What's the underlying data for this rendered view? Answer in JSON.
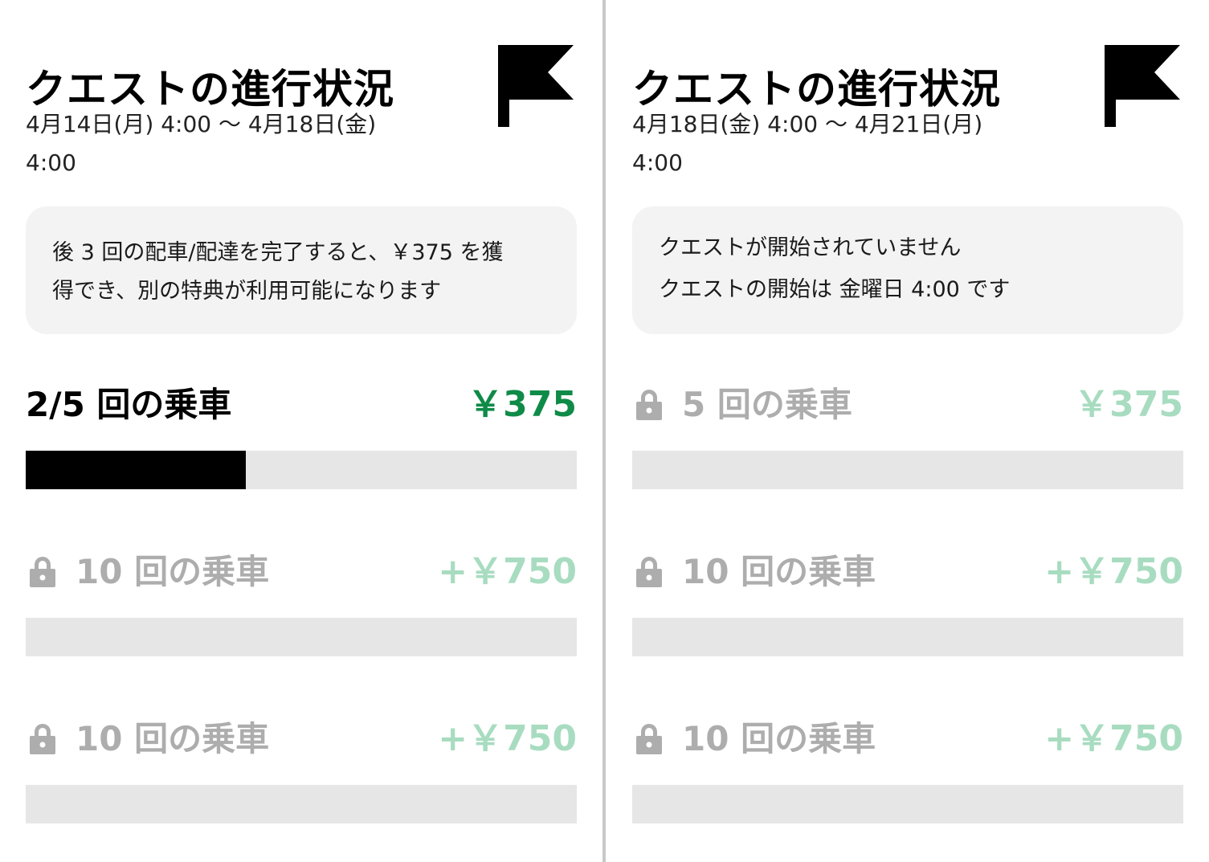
{
  "colors": {
    "reward_active": "#0f8b48",
    "reward_muted": "#a8dcc0",
    "label_muted": "#adadad",
    "track": "#e6e6e6",
    "fill": "#000000",
    "notice_bg": "#f3f3f3",
    "divider": "#c8c8c8"
  },
  "icons": {
    "flag": "flag-icon",
    "lock": "lock-icon"
  },
  "left": {
    "title": "クエストの進行状況",
    "date_line1": "4月14日(月) 4:00 〜 4月18日(金)",
    "date_line2": "4:00",
    "notice_line1": "後 3 回の配車/配達を完了すると、￥375 を獲",
    "notice_line2": "得でき、別の特典が利用可能になります",
    "tiers": [
      {
        "label": "2/5 回の乗車",
        "reward": "￥375",
        "progress": 0.4,
        "locked": false
      },
      {
        "label": "10 回の乗車",
        "reward": "+￥750",
        "progress": 0,
        "locked": true
      },
      {
        "label": "10 回の乗車",
        "reward": "+￥750",
        "progress": 0,
        "locked": true
      }
    ]
  },
  "right": {
    "title": "クエストの進行状況",
    "date_line1": "4月18日(金) 4:00 〜 4月21日(月)",
    "date_line2": "4:00",
    "notice_line1": "クエストが開始されていません",
    "notice_line2": "クエストの開始は 金曜日 4:00 です",
    "tiers": [
      {
        "label": "5 回の乗車",
        "reward": "￥375",
        "progress": 0,
        "locked": true
      },
      {
        "label": "10 回の乗車",
        "reward": "+￥750",
        "progress": 0,
        "locked": true
      },
      {
        "label": "10 回の乗車",
        "reward": "+￥750",
        "progress": 0,
        "locked": true
      }
    ]
  }
}
